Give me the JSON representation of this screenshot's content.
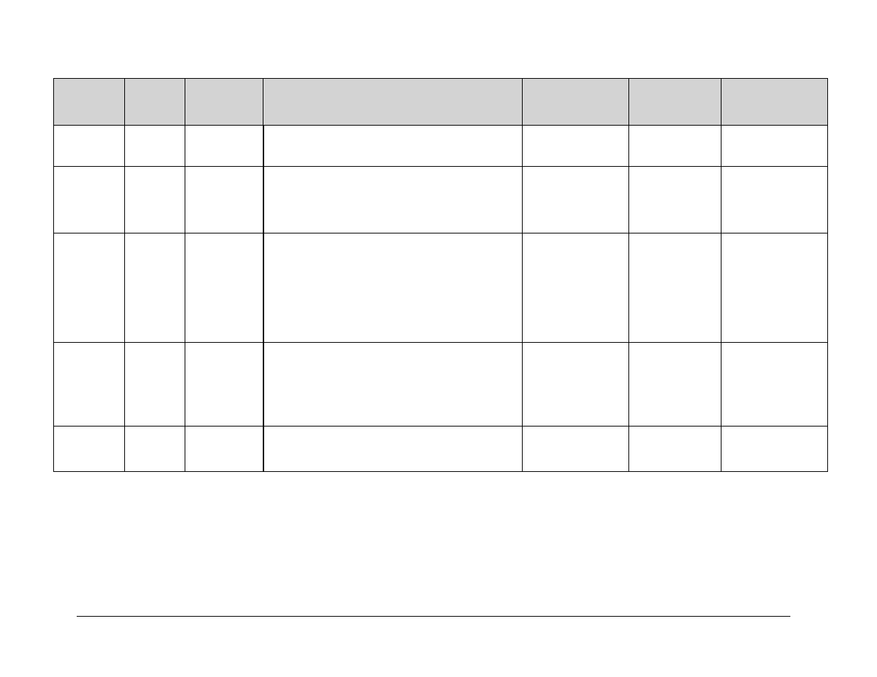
{
  "table": {
    "headers": [
      "",
      "",
      "",
      "",
      "",
      "",
      ""
    ],
    "rows": [
      [
        "",
        "",
        "",
        "",
        "",
        "",
        ""
      ],
      [
        "",
        "",
        "",
        "",
        "",
        "",
        ""
      ],
      [
        "",
        "",
        "",
        "",
        "",
        "",
        ""
      ],
      [
        "",
        "",
        "",
        "",
        "",
        "",
        ""
      ],
      [
        "",
        "",
        "",
        "",
        "",
        "",
        ""
      ]
    ]
  }
}
